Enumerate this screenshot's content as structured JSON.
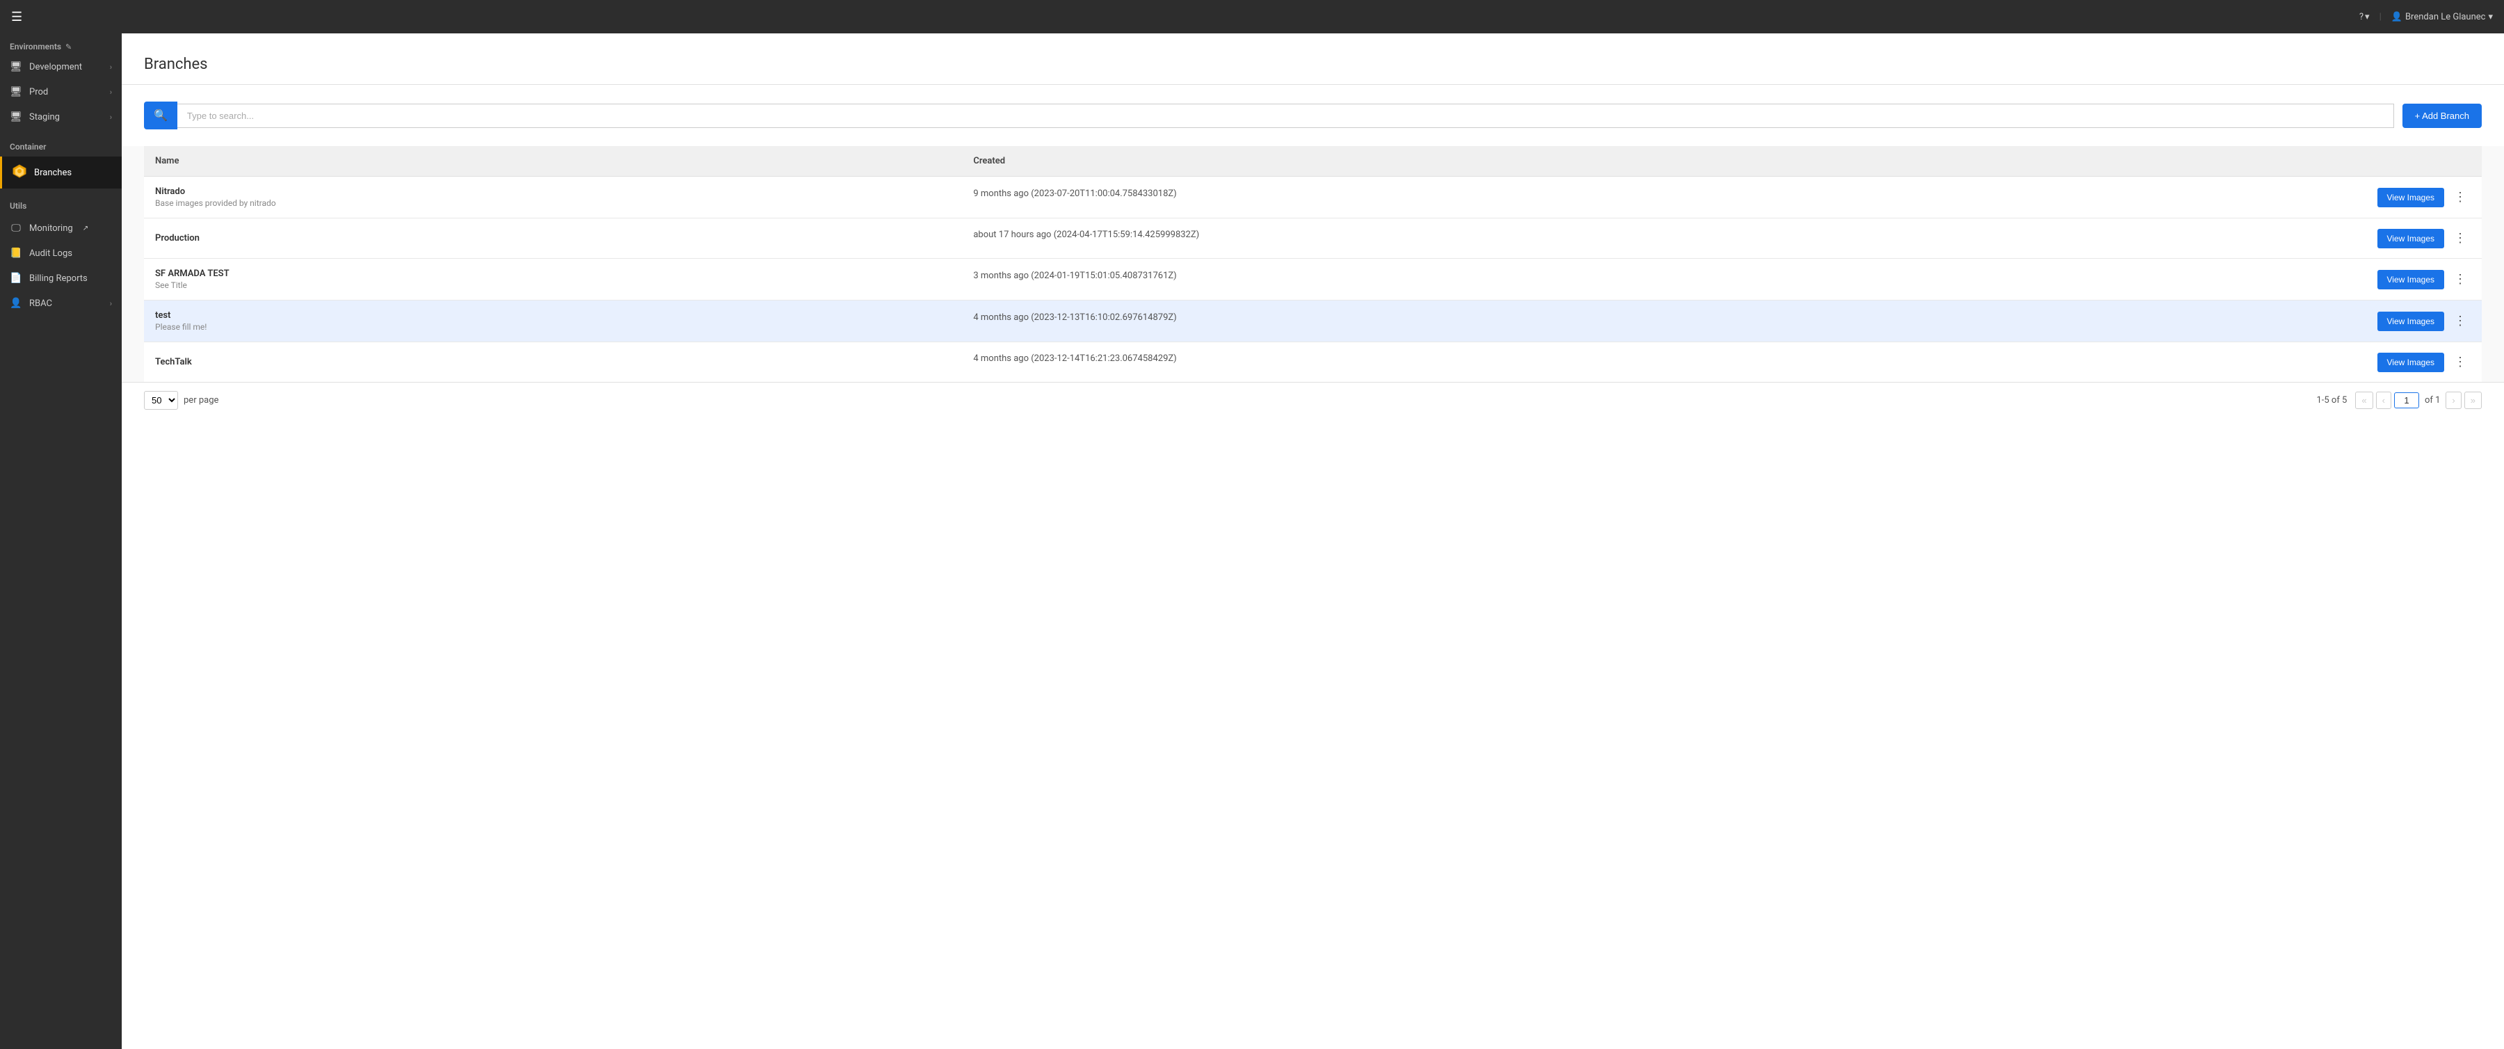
{
  "topbar": {
    "help_label": "?",
    "user_label": "Brendan Le Glaunec",
    "chevron": "▾"
  },
  "sidebar": {
    "section_env": "Environments",
    "edit_icon": "✎",
    "items_env": [
      {
        "id": "development",
        "label": "Development",
        "icon": "🖥"
      },
      {
        "id": "prod",
        "label": "Prod",
        "icon": "🖥"
      },
      {
        "id": "staging",
        "label": "Staging",
        "icon": "🖥"
      }
    ],
    "section_container": "Container",
    "item_branches": {
      "id": "branches",
      "label": "Branches"
    },
    "section_utils": "Utils",
    "items_utils": [
      {
        "id": "monitoring",
        "label": "Monitoring",
        "icon": "🖵",
        "external": true
      },
      {
        "id": "audit-logs",
        "label": "Audit Logs",
        "icon": "📒"
      },
      {
        "id": "billing-reports",
        "label": "Billing Reports",
        "icon": "📄"
      },
      {
        "id": "rbac",
        "label": "RBAC",
        "icon": "👤"
      }
    ]
  },
  "page": {
    "title": "Branches",
    "search_placeholder": "Type to search...",
    "add_branch_label": "+ Add Branch"
  },
  "table": {
    "col_name": "Name",
    "col_created": "Created",
    "rows": [
      {
        "id": "nitrado",
        "name": "Nitrado",
        "desc": "Base images provided by nitrado",
        "created": "9 months ago (2023-07-20T11:00:04.758433018Z)",
        "highlight": false
      },
      {
        "id": "production",
        "name": "Production",
        "desc": "",
        "created": "about 17 hours ago (2024-04-17T15:59:14.425999832Z)",
        "highlight": false
      },
      {
        "id": "sf-armada-test",
        "name": "SF ARMADA TEST",
        "desc": "See Title",
        "created": "3 months ago (2024-01-19T15:01:05.408731761Z)",
        "highlight": false
      },
      {
        "id": "test",
        "name": "test",
        "desc": "Please fill me!",
        "created": "4 months ago (2023-12-13T16:10:02.697614879Z)",
        "highlight": true
      },
      {
        "id": "techtalk",
        "name": "TechTalk",
        "desc": "",
        "created": "4 months ago (2023-12-14T16:21:23.067458429Z)",
        "highlight": false
      }
    ],
    "view_images_label": "View Images",
    "kebab_label": "⋮"
  },
  "pagination": {
    "per_page_value": "50",
    "per_page_label": "per page",
    "range_label": "1-5 of 5",
    "current_page": "1",
    "total_pages": "1",
    "of_label": "of 1"
  }
}
